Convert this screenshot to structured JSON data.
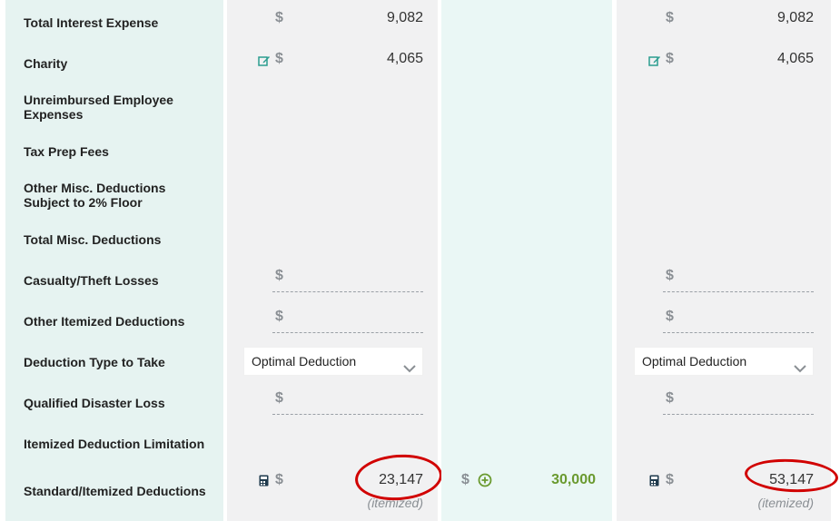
{
  "labels": [
    "Total Interest Expense",
    "Charity",
    "Unreimbursed Employee Expenses",
    "Tax Prep Fees",
    "Other Misc. Deductions Subject to 2% Floor",
    "Total Misc. Deductions",
    "Casualty/Theft Losses",
    "Other Itemized Deductions",
    "Deduction Type to Take",
    "Qualified Disaster Loss",
    "Itemized Deduction Limitation",
    "Standard/Itemized Deductions"
  ],
  "currency": "$",
  "col1": {
    "interest": "9,082",
    "charity": "4,065",
    "deduction_type": "Optimal Deduction",
    "total": "23,147",
    "total_note": "(itemized)"
  },
  "col2": {
    "total": "30,000"
  },
  "col3": {
    "interest": "9,082",
    "charity": "4,065",
    "deduction_type": "Optimal Deduction",
    "total": "53,147",
    "total_note": "(itemized)"
  },
  "colors": {
    "label_bg": "#e6f3f1",
    "data_bg": "#f1f1f2",
    "middle_bg": "#eaf7f5",
    "accent_green": "#6a9a2f",
    "edit_teal": "#2a9d8f",
    "annotation_red": "#d10000"
  },
  "icons": [
    "edit-icon",
    "calculator-icon",
    "add-circle-icon",
    "chevron-down-icon"
  ]
}
